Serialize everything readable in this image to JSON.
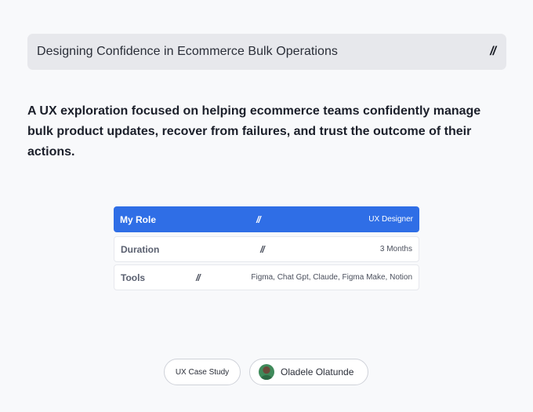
{
  "header": {
    "title": "Designing Confidence in Ecommerce Bulk Operations",
    "separator": "//"
  },
  "intro": {
    "text": "A UX exploration focused on helping ecommerce teams confidently manage bulk product updates, recover from failures, and trust the outcome of their actions."
  },
  "meta": {
    "separator": "//",
    "rows": [
      {
        "label": "My Role",
        "value": "UX Designer",
        "active": true
      },
      {
        "label": "Duration",
        "value": "3 Months",
        "active": false
      },
      {
        "label": "Tools",
        "value": "Figma, Chat Gpt, Claude, Figma Make, Notion",
        "active": false
      }
    ]
  },
  "footer": {
    "tag": "UX Case Study",
    "author": "Oladele Olatunde",
    "author_icon": "avatar"
  },
  "colors": {
    "accent": "#2f6ee6",
    "background": "#f8f9fb",
    "title_bar": "#e7e8ec"
  }
}
